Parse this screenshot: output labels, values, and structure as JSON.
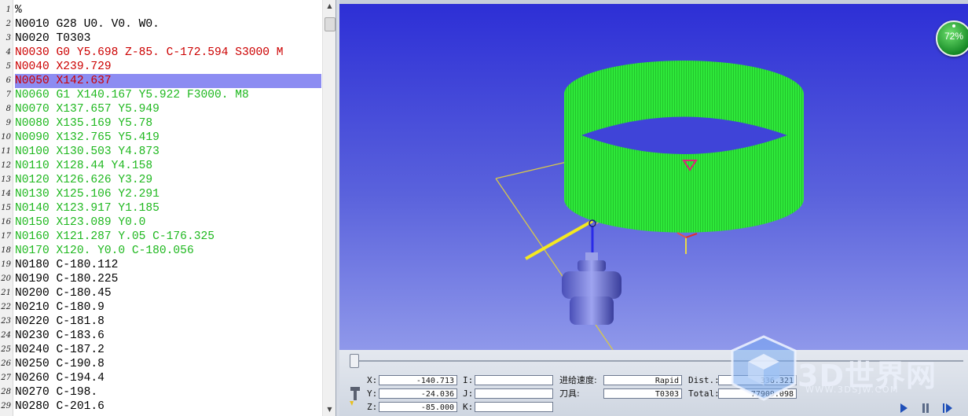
{
  "editor": {
    "lines": [
      {
        "num": "1",
        "text": "%",
        "color": "#000000"
      },
      {
        "num": "2",
        "text": "N0010 G28 U0. V0. W0.",
        "color": "#000000"
      },
      {
        "num": "3",
        "text": "N0020 T0303",
        "color": "#000000"
      },
      {
        "num": "4",
        "text": "N0030 G0 Y5.698 Z-85. C-172.594 S3000 M",
        "color": "#cc0000"
      },
      {
        "num": "5",
        "text": "N0040 X239.729",
        "color": "#cc0000"
      },
      {
        "num": "6",
        "text": "N0050 X142.637",
        "color": "#cc0000",
        "highlight": true
      },
      {
        "num": "7",
        "text": "N0060 G1 X140.167 Y5.922 F3000. M8",
        "color": "#1fb81f"
      },
      {
        "num": "8",
        "text": "N0070 X137.657 Y5.949",
        "color": "#1fb81f"
      },
      {
        "num": "9",
        "text": "N0080 X135.169 Y5.78",
        "color": "#1fb81f"
      },
      {
        "num": "10",
        "text": "N0090 X132.765 Y5.419",
        "color": "#1fb81f"
      },
      {
        "num": "11",
        "text": "N0100 X130.503 Y4.873",
        "color": "#1fb81f"
      },
      {
        "num": "12",
        "text": "N0110 X128.44 Y4.158",
        "color": "#1fb81f"
      },
      {
        "num": "13",
        "text": "N0120 X126.626 Y3.29",
        "color": "#1fb81f"
      },
      {
        "num": "14",
        "text": "N0130 X125.106 Y2.291",
        "color": "#1fb81f"
      },
      {
        "num": "15",
        "text": "N0140 X123.917 Y1.185",
        "color": "#1fb81f"
      },
      {
        "num": "16",
        "text": "N0150 X123.089 Y0.0",
        "color": "#1fb81f"
      },
      {
        "num": "17",
        "text": "N0160 X121.287 Y.05 C-176.325",
        "color": "#1fb81f"
      },
      {
        "num": "18",
        "text": "N0170 X120. Y0.0 C-180.056",
        "color": "#1fb81f"
      },
      {
        "num": "19",
        "text": "N0180 C-180.112",
        "color": "#000000"
      },
      {
        "num": "20",
        "text": "N0190 C-180.225",
        "color": "#000000"
      },
      {
        "num": "21",
        "text": "N0200 C-180.45",
        "color": "#000000"
      },
      {
        "num": "22",
        "text": "N0210 C-180.9",
        "color": "#000000"
      },
      {
        "num": "23",
        "text": "N0220 C-181.8",
        "color": "#000000"
      },
      {
        "num": "24",
        "text": "N0230 C-183.6",
        "color": "#000000"
      },
      {
        "num": "25",
        "text": "N0240 C-187.2",
        "color": "#000000"
      },
      {
        "num": "26",
        "text": "N0250 C-190.8",
        "color": "#000000"
      },
      {
        "num": "27",
        "text": "N0260 C-194.4",
        "color": "#000000"
      },
      {
        "num": "28",
        "text": "N0270 C-198.",
        "color": "#000000"
      },
      {
        "num": "29",
        "text": "N0280 C-201.6",
        "color": "#000000"
      }
    ]
  },
  "viewport": {
    "zoom_percent": "72%",
    "background_top": "#2d2fd6",
    "part_color": "#2ee83a"
  },
  "readout": {
    "x_label": "X:",
    "x_value": "-140.713",
    "y_label": "Y:",
    "y_value": "-24.036",
    "z_label": "Z:",
    "z_value": "-85.000",
    "i_label": "I:",
    "i_value": "",
    "j_label": "J:",
    "j_value": "",
    "k_label": "K:",
    "k_value": "",
    "feed_label": "进给速度:",
    "feed_value": "Rapid",
    "tool_label": "刀具:",
    "tool_value": "T0303",
    "dist_label": "Dist.:",
    "dist_value": "336.321",
    "total_label": "Total:",
    "total_value": "77909.098"
  },
  "watermark": {
    "text": "3D世界网",
    "url": "WWW.3DSJW.COM"
  },
  "icons": {
    "tool_icon": "tool-holder-icon",
    "play": "play-icon",
    "pause": "pause-icon",
    "step": "step-forward-icon"
  }
}
